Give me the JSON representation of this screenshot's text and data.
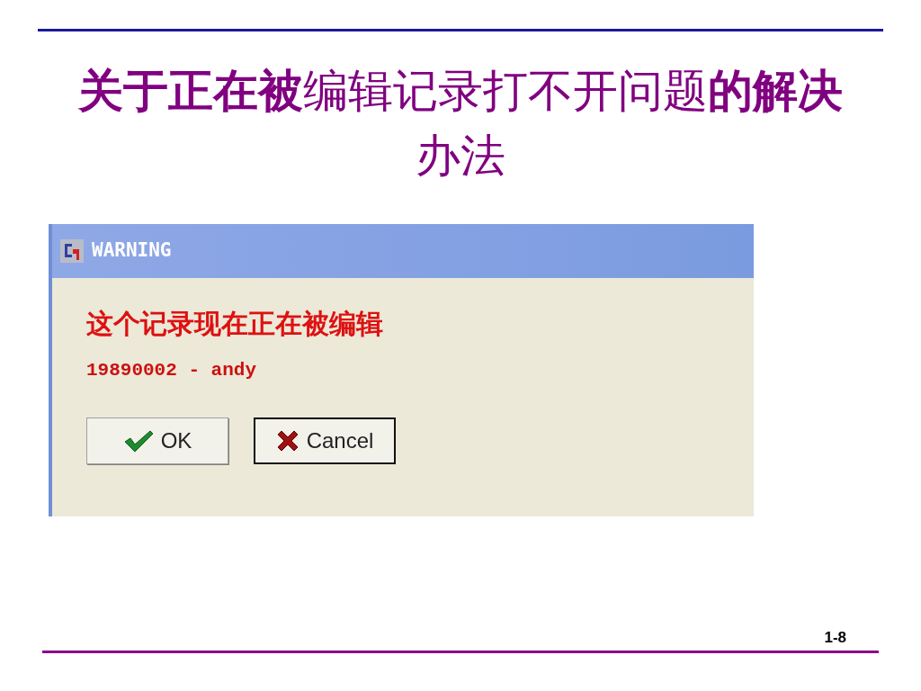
{
  "slide": {
    "title": "**关于正在被**编辑记录打不开问题**的解决**办法",
    "page_number": "1-8"
  },
  "dialog": {
    "title": "WARNING",
    "message": "这个记录现在正在被编辑",
    "detail": "19890002 - andy",
    "buttons": [
      {
        "label": "OK",
        "kind": "ok",
        "focused": false
      },
      {
        "label": "Cancel",
        "kind": "cancel",
        "focused": true
      }
    ]
  }
}
